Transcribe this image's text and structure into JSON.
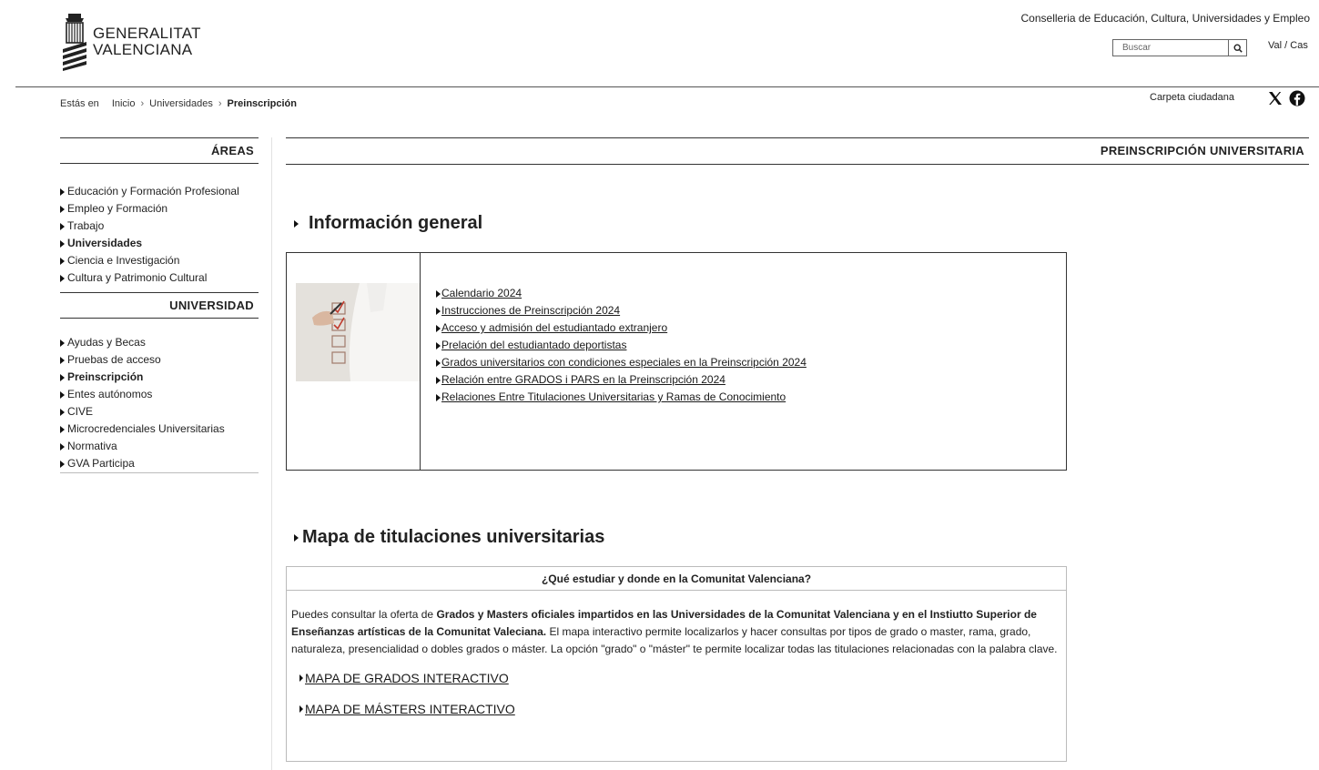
{
  "header": {
    "logo_line1": "GENERALITAT",
    "logo_line2": "VALENCIANA",
    "conselleria": "Conselleria de Educación, Cultura, Universidades y Empleo",
    "search_placeholder": "Buscar",
    "lang_val": "Val",
    "lang_sep": " / ",
    "lang_cas": "Cas",
    "carpeta": "Carpeta ciudadana"
  },
  "breadcrumb": {
    "lead": "Estás en",
    "items": [
      "Inicio",
      "Universidades",
      "Preinscripción"
    ]
  },
  "sidebar": {
    "areas_title": "ÁREAS",
    "areas": [
      {
        "label": "Educación y Formación Profesional",
        "active": false
      },
      {
        "label": "Empleo y Formación",
        "active": false
      },
      {
        "label": "Trabajo",
        "active": false
      },
      {
        "label": "Universidades",
        "active": true
      },
      {
        "label": "Ciencia e Investigación",
        "active": false
      },
      {
        "label": "Cultura y Patrimonio Cultural",
        "active": false
      }
    ],
    "univ_title": "UNIVERSIDAD",
    "univ": [
      {
        "label": "Ayudas y Becas",
        "active": false
      },
      {
        "label": "Pruebas de acceso",
        "active": false
      },
      {
        "label": "Preinscripción",
        "active": true
      },
      {
        "label": "Entes autónomos",
        "active": false
      },
      {
        "label": "CIVE",
        "active": false
      },
      {
        "label": "Microcredenciales Universitarias",
        "active": false
      },
      {
        "label": "Normativa",
        "active": false
      },
      {
        "label": "GVA Participa",
        "active": false
      }
    ]
  },
  "main": {
    "page_title": "PREINSCRIPCIÓN UNIVERSITARIA",
    "info_title": "Información general",
    "info_links": [
      "Calendario 2024",
      "Instrucciones de Preinscripción 2024",
      "Acceso y admisión del estudiantado extranjero",
      "Prelación del estudiantado deportistas",
      "Grados universitarios con condiciones especiales en la Preinscripción 2024 ",
      "Relación entre GRADOS i PARS en la Preinscripción 2024",
      "Relaciones Entre Titulaciones Universitarias y Ramas de Conocimiento "
    ],
    "mapa_title": "Mapa de titulaciones universitarias",
    "mapa_head": "¿Qué estudiar y donde en la Comunitat Valenciana?",
    "mapa_text_1": "Puedes consultar la oferta de ",
    "mapa_text_bold": "Grados y Masters oficiales impartidos en las Universidades de la Comunitat Valenciana y en el Instiutto Superior de Enseñanzas artísticas de la Comunitat Valeciana.",
    "mapa_text_2": " El mapa interactivo permite localizarlos y hacer consultas por tipos de grado o master, rama, grado, naturaleza, presencialidad o dobles grados o máster. La opción \"grado\" o \"máster\" te permite localizar todas las titulaciones relacionadas con la palabra clave.",
    "mapa_grados": "MAPA DE GRADOS INTERACTIVO",
    "mapa_masters": "MAPA DE MÁSTERS INTERACTIVO"
  }
}
